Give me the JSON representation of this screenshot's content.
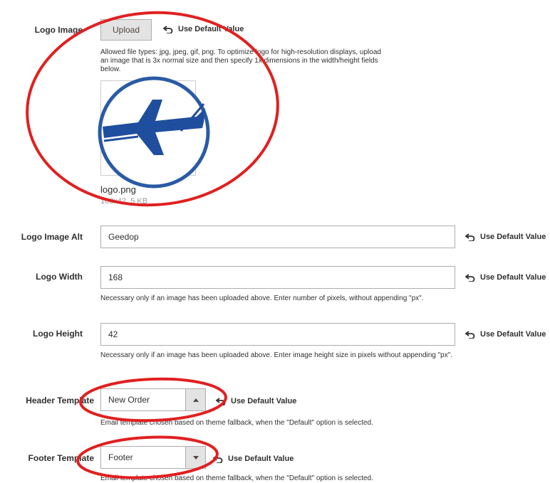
{
  "logo_image": {
    "label": "Logo Image",
    "upload_label": "Upload",
    "use_default": "Use Default Value",
    "note": "Allowed file types: jpg, jpeg, gif, png. To optimize logo for high-resolution displays, upload an image that is 3x normal size and then specify 1x dimensions in the width/height fields below.",
    "file_name": "logo.png",
    "file_meta": "168x42, 5 KB"
  },
  "logo_alt": {
    "label": "Logo Image Alt",
    "value": "Geedop",
    "use_default": "Use Default Value"
  },
  "logo_width": {
    "label": "Logo Width",
    "value": "168",
    "use_default": "Use Default Value",
    "note": "Necessary only if an image has been uploaded above. Enter number of pixels, without appending \"px\"."
  },
  "logo_height": {
    "label": "Logo Height",
    "value": "42",
    "use_default": "Use Default Value",
    "note": "Necessary only if an image has been uploaded above. Enter image height size in pixels without appending \"px\"."
  },
  "header_template": {
    "label": "Header Template",
    "selected": "New Order",
    "use_default": "Use Default Value",
    "note": "Email template chosen based on theme fallback, when the \"Default\" option is selected."
  },
  "footer_template": {
    "label": "Footer Template",
    "selected": "Footer",
    "use_default": "Use Default Value",
    "note": "Email template chosen based on theme fallback, when the \"Default\" option is selected."
  },
  "colors": {
    "annotation": "#e02020",
    "logo_blue": "#1f4e9e",
    "logo_ring": "#2a5aa5"
  },
  "icons": [
    "undo-arrow-icon",
    "caret-up-icon",
    "caret-down-icon",
    "airplane-logo-icon"
  ]
}
